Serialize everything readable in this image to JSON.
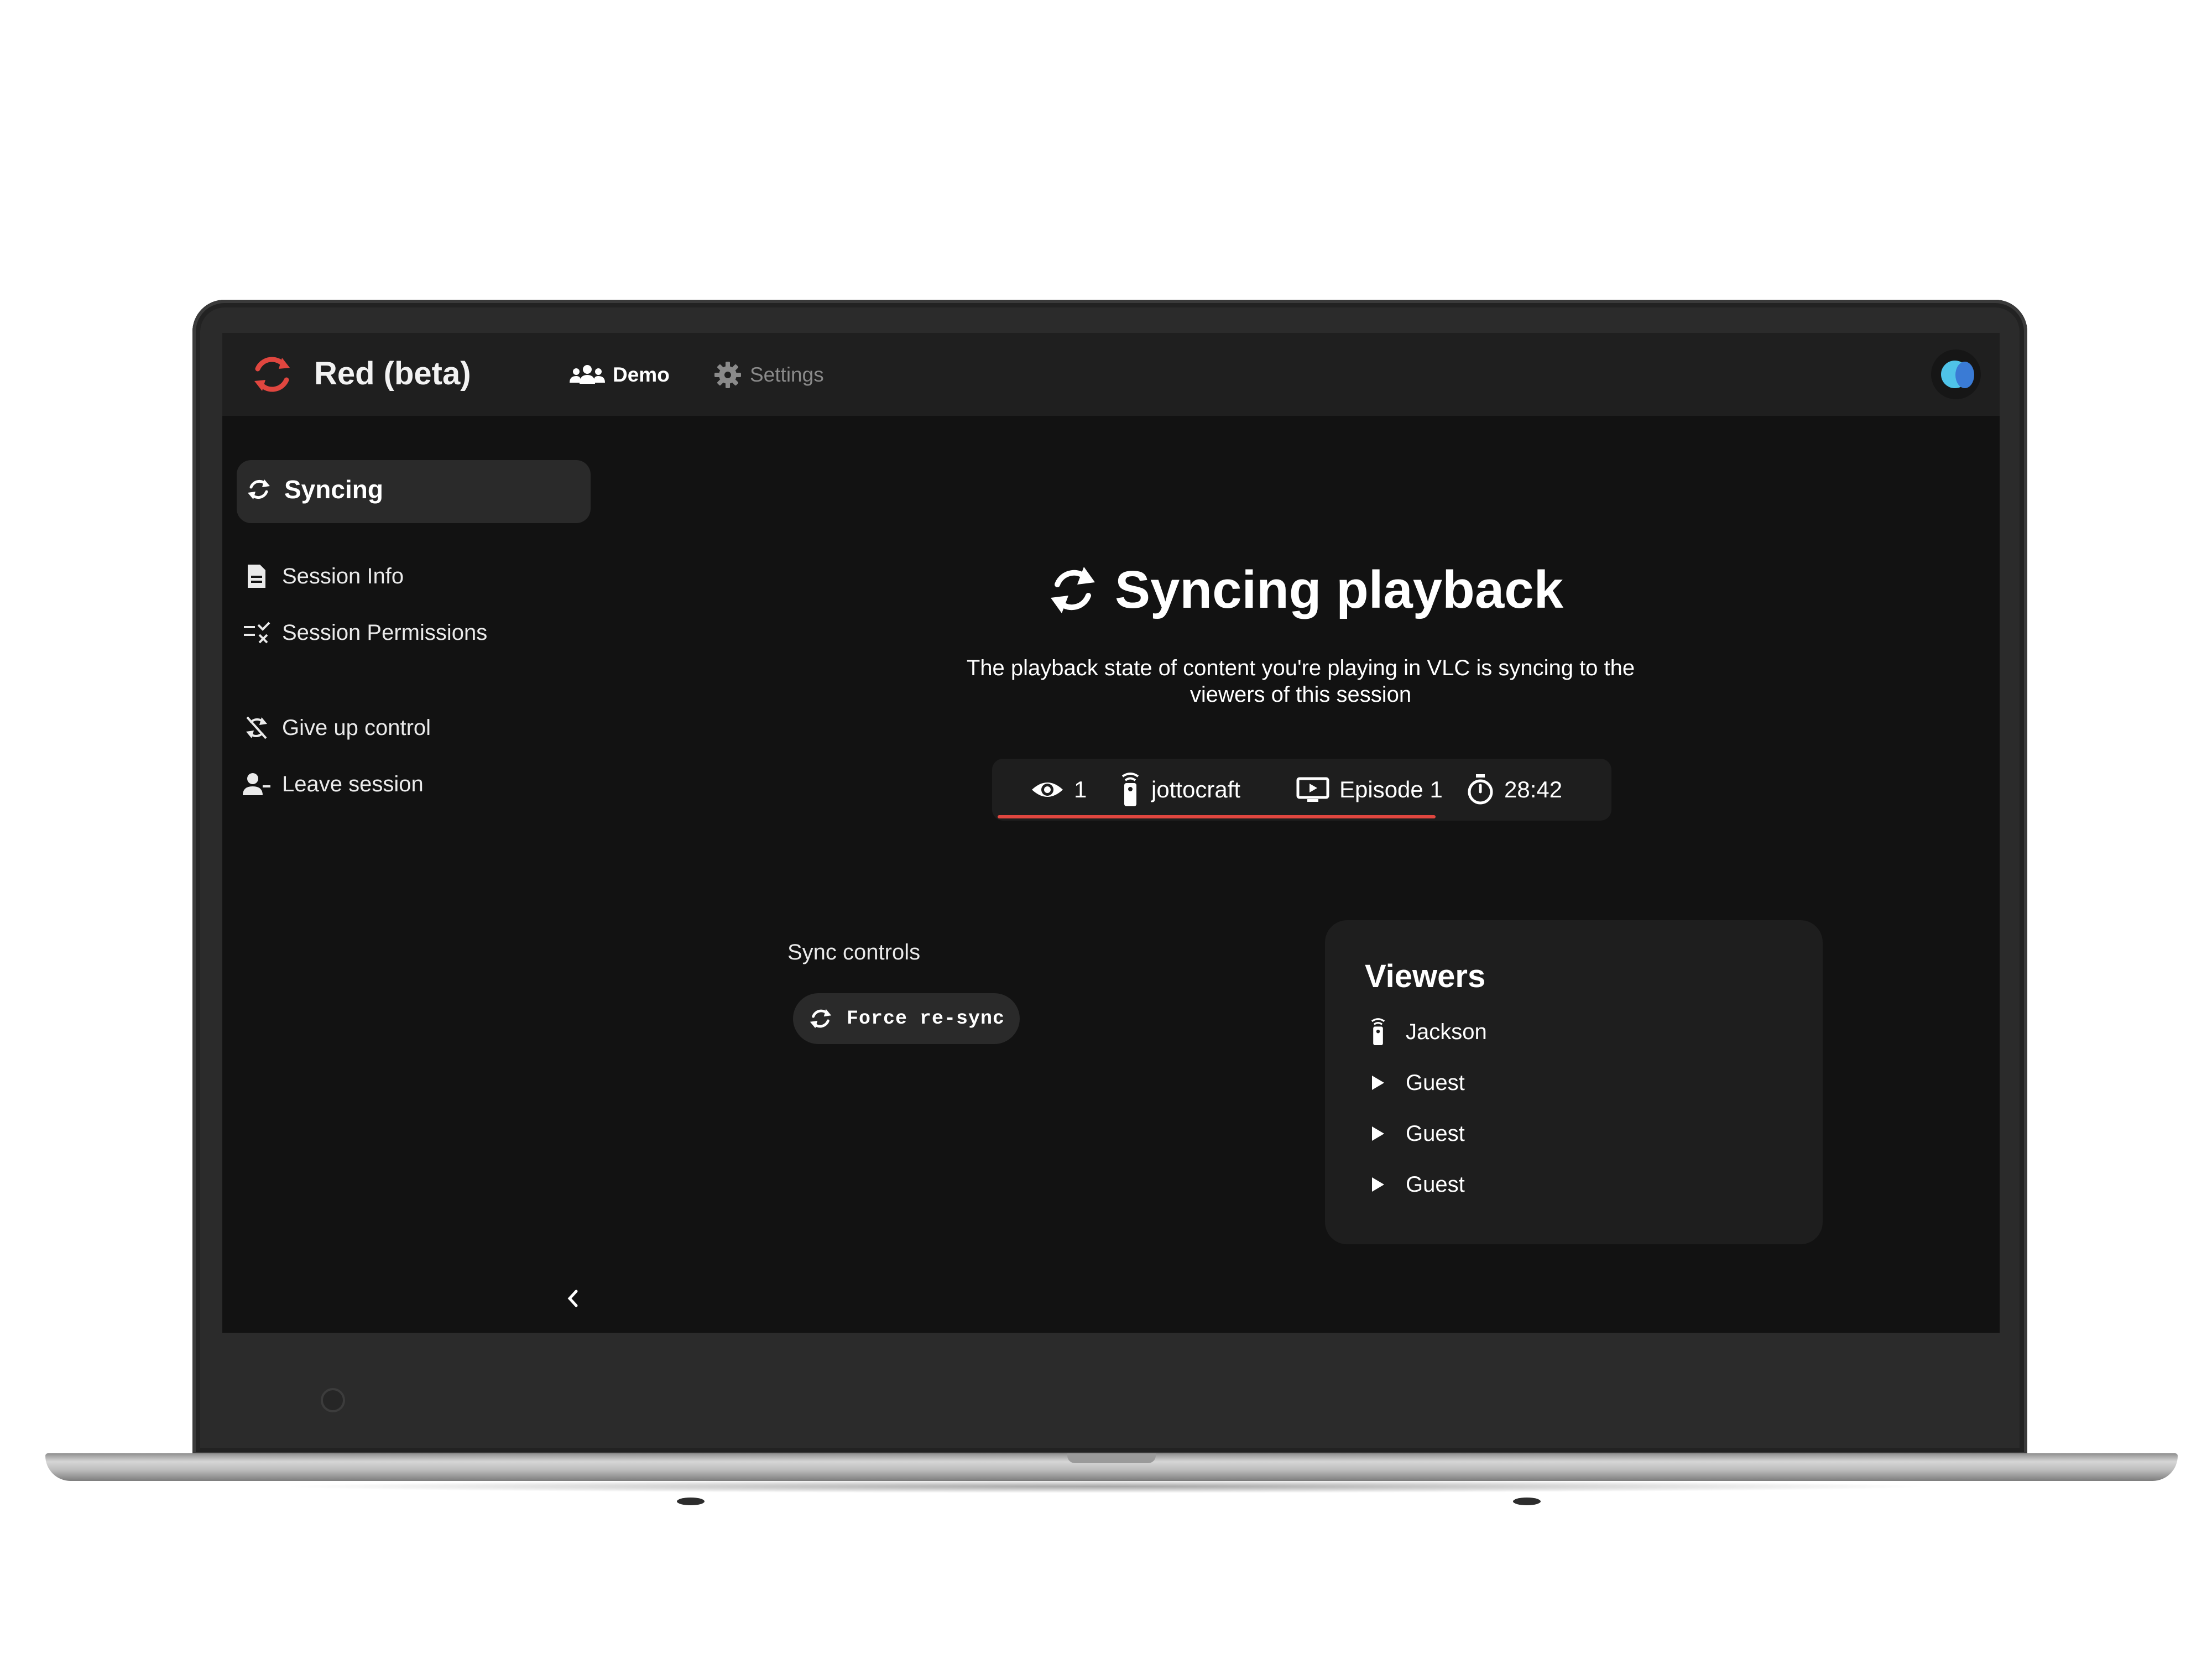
{
  "app": {
    "name": "Red (beta)",
    "accent_color": "#e0463f",
    "logo_icon": "sync-arrows-icon"
  },
  "topnav": {
    "items": [
      {
        "label": "Demo",
        "icon": "users-icon",
        "active": true
      },
      {
        "label": "Settings",
        "icon": "gear-icon",
        "active": false
      }
    ]
  },
  "sidebar": {
    "active": {
      "label": "Syncing",
      "icon": "sync-icon"
    },
    "items": [
      {
        "label": "Session Info",
        "icon": "document-icon"
      },
      {
        "label": "Session Permissions",
        "icon": "list-check-icon"
      },
      {
        "label": "Give up control",
        "icon": "sync-off-icon"
      },
      {
        "label": "Leave session",
        "icon": "user-minus-icon"
      }
    ],
    "collapse_icon": "chevron-left-icon"
  },
  "main": {
    "title": "Syncing playback",
    "subtitle": "The playback state of content you're playing in VLC is syncing to the viewers of this session",
    "status": {
      "viewers_count": "1",
      "controller": "jottocraft",
      "media": "Episode 1",
      "time": "28:42",
      "progress_fraction": 0.72,
      "progress_color": "#e0463f"
    },
    "sync_controls": {
      "label": "Sync controls",
      "force_resync_label": "Force re-sync"
    },
    "viewers": {
      "title": "Viewers",
      "list": [
        {
          "name": "Jackson",
          "icon": "remote-icon"
        },
        {
          "name": "Guest",
          "icon": "play-icon"
        },
        {
          "name": "Guest",
          "icon": "play-icon"
        },
        {
          "name": "Guest",
          "icon": "play-icon"
        }
      ]
    }
  }
}
